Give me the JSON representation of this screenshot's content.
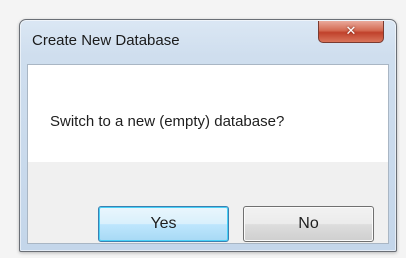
{
  "dialog": {
    "title": "Create New Database",
    "close_icon": "close-icon",
    "close_glyph": "✕",
    "message": "Switch to a new (empty) database?",
    "buttons": {
      "yes_label": "Yes",
      "no_label": "No"
    }
  },
  "colors": {
    "title_bar": "#cfdeee",
    "close_button": "#c0412b",
    "default_button_border": "#3c7fb1"
  }
}
